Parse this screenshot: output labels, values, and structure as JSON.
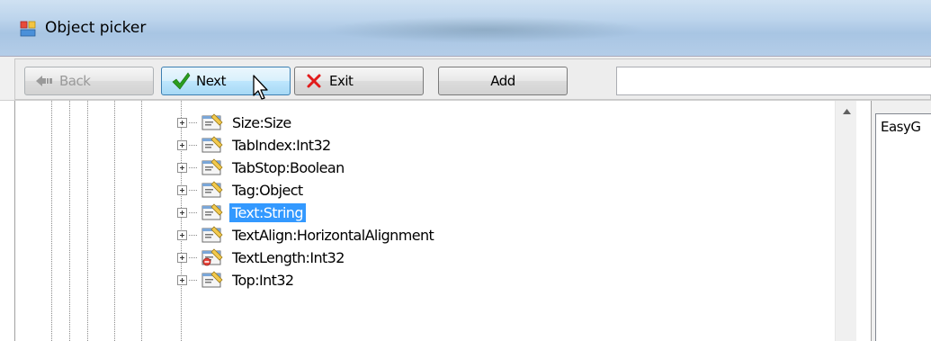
{
  "window": {
    "title": "Object picker",
    "icon": "window-app-icon"
  },
  "toolbar": {
    "back_label": "Back",
    "next_label": "Next",
    "exit_label": "Exit",
    "add_label": "Add",
    "search_value": ""
  },
  "tree": {
    "items": [
      {
        "label": "Size:Size",
        "icon": "property-icon",
        "selected": false
      },
      {
        "label": "TabIndex:Int32",
        "icon": "property-icon",
        "selected": false
      },
      {
        "label": "TabStop:Boolean",
        "icon": "property-icon",
        "selected": false
      },
      {
        "label": "Tag:Object",
        "icon": "property-icon",
        "selected": false
      },
      {
        "label": "Text:String",
        "icon": "property-icon",
        "selected": true
      },
      {
        "label": "TextAlign:HorizontalAlignment",
        "icon": "property-icon",
        "selected": false
      },
      {
        "label": "TextLength:Int32",
        "icon": "readonly-property-icon",
        "selected": false
      },
      {
        "label": "Top:Int32",
        "icon": "property-icon",
        "selected": false
      }
    ]
  },
  "right_panel": {
    "text": "EasyG"
  },
  "colors": {
    "selection": "#3399ff",
    "titlebar": "#bcd4ec"
  }
}
